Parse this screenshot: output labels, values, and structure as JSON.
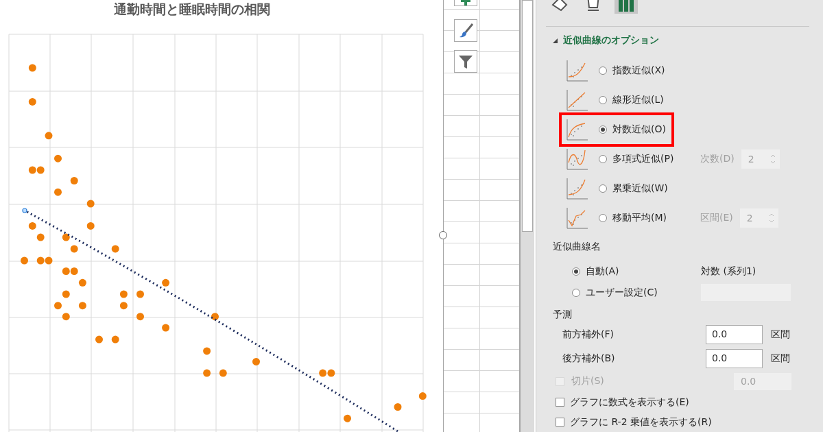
{
  "chart": {
    "title": "通勤時間と睡眠時間の相関"
  },
  "chart_buttons": [
    {
      "kind": "add"
    },
    {
      "kind": "style"
    },
    {
      "kind": "filter"
    }
  ],
  "format_pane": {
    "tabs": [
      {
        "kind": "fill",
        "selected": false
      },
      {
        "kind": "effects",
        "selected": false
      },
      {
        "kind": "options",
        "selected": true
      }
    ],
    "section": {
      "title": "近似曲線のオプション",
      "expanded": true
    },
    "trendline_types": [
      {
        "kind": "exponential",
        "label": "指数近似(X)",
        "selected": false,
        "highlighted": false
      },
      {
        "kind": "linear",
        "label": "線形近似(L)",
        "selected": false,
        "highlighted": false
      },
      {
        "kind": "logarithmic",
        "label": "対数近似(O)",
        "selected": true,
        "highlighted": true
      },
      {
        "kind": "polynomial",
        "label": "多項式近似(P)",
        "selected": false,
        "highlighted": false,
        "param": {
          "label": "次数(D)",
          "value": "2",
          "disabled": true
        }
      },
      {
        "kind": "power",
        "label": "累乗近似(W)",
        "selected": false,
        "highlighted": false
      },
      {
        "kind": "moving_average",
        "label": "移動平均(M)",
        "selected": false,
        "highlighted": false,
        "param": {
          "label": "区間(E)",
          "value": "2",
          "disabled": true
        }
      }
    ],
    "trendline_name": {
      "title": "近似曲線名",
      "options": [
        {
          "label": "自動(A)",
          "selected": true,
          "value": "対数 (系列1)"
        },
        {
          "label": "ユーザー設定(C)",
          "selected": false
        }
      ]
    },
    "forecast": {
      "title": "予測",
      "rows": [
        {
          "label": "前方補外(F)",
          "value": "0.0",
          "unit": "区間"
        },
        {
          "label": "後方補外(B)",
          "value": "0.0",
          "unit": "区間"
        }
      ]
    },
    "intercept": {
      "label": "切片(S)",
      "checked": false,
      "disabled": true,
      "value": "0.0"
    },
    "checkboxes": [
      {
        "label": "グラフに数式を表示する(E)",
        "checked": false
      },
      {
        "label": "グラフに R-2 乗値を表示する(R)",
        "checked": false
      }
    ]
  }
}
